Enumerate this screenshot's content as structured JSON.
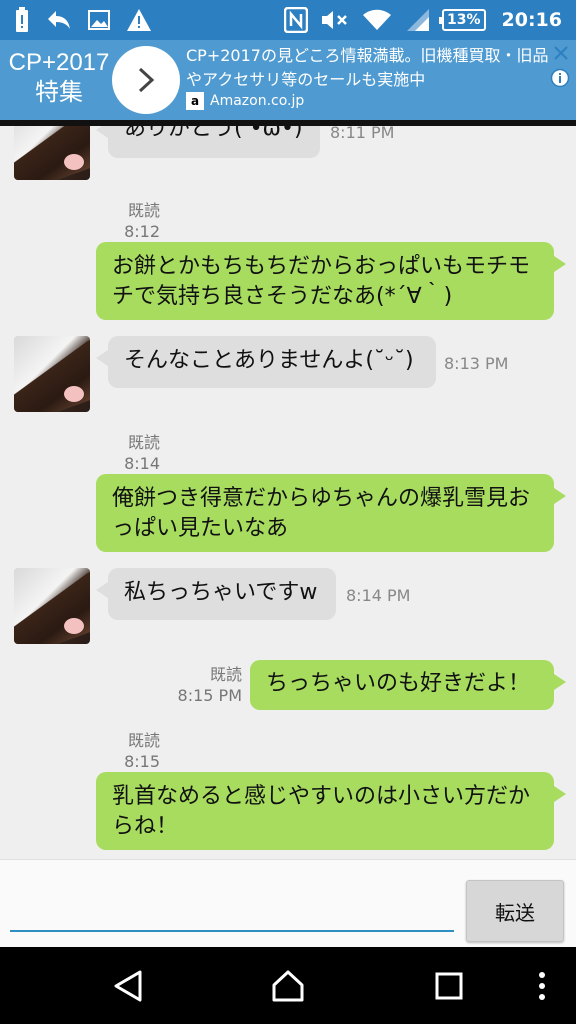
{
  "status_bar": {
    "battery_level": "13%",
    "time": "20:16"
  },
  "ad": {
    "title_line1": "CP+2017",
    "title_line2": "特集",
    "text": "CP+2017の見どころ情報満載。旧機種買取・旧品やアクセサリ等のセールも実施中",
    "source": "Amazon.co.jp",
    "source_logo": "a"
  },
  "messages": [
    {
      "dir": "in",
      "text": "ありがとう( •ω•)",
      "time": "8:11 PM"
    },
    {
      "dir": "out",
      "read": "既読",
      "time": "8:12 PM",
      "text": "お餅とかもちもちだからおっぱいもモチモチで気持ち良さそうだなあ(*´∀｀)"
    },
    {
      "dir": "in",
      "text": "そんなことありませんよ(˘ᵕ˘)",
      "time": "8:13 PM"
    },
    {
      "dir": "out",
      "read": "既読",
      "time": "8:14 PM",
      "text": "俺餅つき得意だからゆちゃんの爆乳雪見おっぱい見たいなあ"
    },
    {
      "dir": "in",
      "text": "私ちっちゃいですw",
      "time": "8:14 PM"
    },
    {
      "dir": "out",
      "read": "既読",
      "time": "8:15 PM",
      "text": "ちっちゃいのも好きだよ！"
    },
    {
      "dir": "out",
      "read": "既読",
      "time": "8:15 PM",
      "text": "乳首なめると感じやすいのは小さい方だからね！"
    }
  ],
  "input": {
    "value": "",
    "send_label": "転送"
  },
  "colors": {
    "status_bar": "#2c7fc0",
    "ad_banner": "#4f9bd1",
    "outgoing_bubble": "#a7dc5f",
    "incoming_bubble": "#dedede",
    "input_underline": "#2c8fc0"
  }
}
